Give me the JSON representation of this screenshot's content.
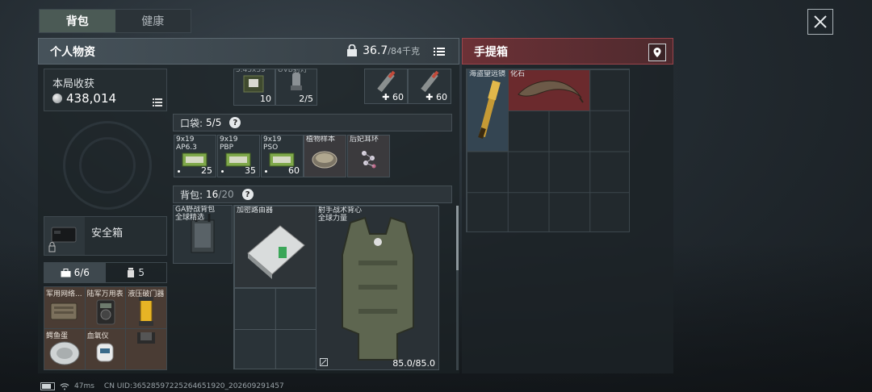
{
  "tabs": [
    {
      "label": "背包",
      "active": true
    },
    {
      "label": "健康",
      "active": false
    }
  ],
  "left_header": {
    "title": "个人物资",
    "weight_current": "36.7",
    "weight_max": "/84千克"
  },
  "right_header": {
    "title": "手提箱"
  },
  "earnings": {
    "label": "本局收获",
    "value": "438,014"
  },
  "safe_box": {
    "label": "安全箱"
  },
  "storage_tabs": [
    {
      "label": "6/6",
      "active": true
    },
    {
      "label": "5",
      "active": false
    }
  ],
  "storage_items": [
    {
      "name": "军用网络..."
    },
    {
      "name": "陆军万用表"
    },
    {
      "name": "液压破门器"
    },
    {
      "name": "鳄鱼蛋"
    },
    {
      "name": "血氧仪"
    },
    {
      "name": ""
    }
  ],
  "top_items": [
    {
      "name": "5.45x39",
      "count": "10"
    },
    {
      "name": "UVB射灯",
      "count": "2/5"
    },
    {
      "name": "",
      "count": "60"
    },
    {
      "name": "",
      "count": "60"
    }
  ],
  "pocket": {
    "label": "口袋:",
    "count": "5/5",
    "help": "?"
  },
  "pocket_items": [
    {
      "name": "9x19",
      "sub": "AP6.3",
      "count": "25"
    },
    {
      "name": "9x19",
      "sub": "PBP",
      "count": "35"
    },
    {
      "name": "9x19",
      "sub": "PSO",
      "count": "60"
    },
    {
      "name": "植物样本",
      "sub": "",
      "count": ""
    },
    {
      "name": "后妃耳环",
      "sub": "",
      "count": ""
    }
  ],
  "backpack": {
    "label": "背包:",
    "count": "16",
    "max": "/20",
    "help": "?"
  },
  "bag_items": [
    {
      "name": "GA野战背包",
      "sub": "全球精选"
    },
    {
      "name": "加密路由器",
      "sub": ""
    },
    {
      "name": "射手战术背心",
      "sub": "全球力量",
      "durability": "85.0/85.0"
    }
  ],
  "case_items": [
    {
      "name": "海盗望远镜"
    },
    {
      "name": "化石"
    }
  ],
  "status_bar": {
    "ping": "47ms",
    "uid": "CN UID:365285972252646519​20_202609291457"
  },
  "colors": {
    "accent_green": "#4b5a55",
    "case_red": "#6c3136",
    "storage_brown": "#4a3c34",
    "fossil_red": "#6b2a2d"
  }
}
